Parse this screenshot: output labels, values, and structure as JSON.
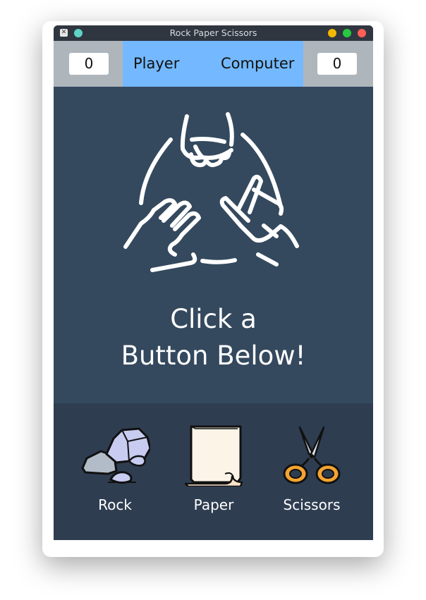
{
  "window": {
    "title": "Rock Paper Scissors"
  },
  "scoreboard": {
    "player_score": "0",
    "player_label": "Player",
    "computer_label": "Computer",
    "computer_score": "0"
  },
  "main": {
    "message_line1": "Click a",
    "message_line2": "Button Below!",
    "illustration": "rock-paper-scissors-hands-icon"
  },
  "choices": [
    {
      "label": "Rock",
      "icon": "rock-icon"
    },
    {
      "label": "Paper",
      "icon": "paper-icon"
    },
    {
      "label": "Scissors",
      "icon": "scissors-icon"
    }
  ],
  "colors": {
    "score_highlight": "#74b9ff",
    "score_side": "#aeb6bc",
    "content_bg": "#34495e",
    "bottom_bg": "#2f3d51",
    "titlebar_bg": "#2f3640",
    "btn_minimize": "#f5b800",
    "btn_maximize": "#28c840",
    "btn_close": "#ff5f57"
  }
}
